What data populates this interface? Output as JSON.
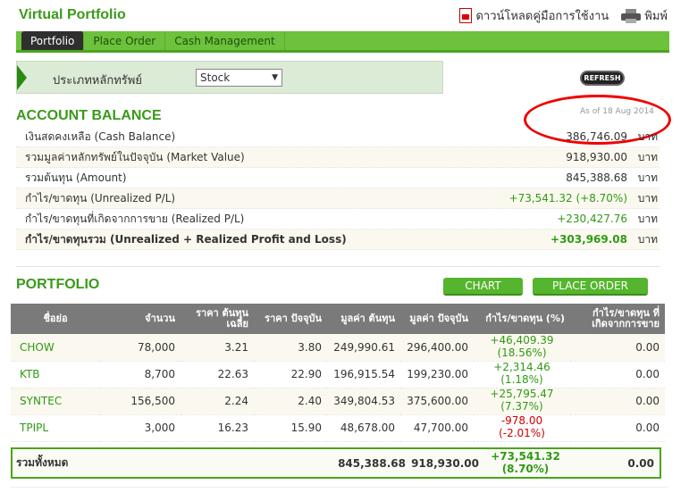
{
  "header": {
    "title": "Virtual Portfolio",
    "download_manual": "ดาวน์โหลดคู่มือการใช้งาน",
    "print": "พิมพ์"
  },
  "tabs": [
    {
      "label": "Portfolio",
      "active": true
    },
    {
      "label": "Place Order",
      "active": false
    },
    {
      "label": "Cash Management",
      "active": false
    }
  ],
  "filter": {
    "label": "ประเภทหลักทรัพย์",
    "selected": "Stock"
  },
  "refresh_label": "REFRESH",
  "account_balance": {
    "title": "ACCOUNT BALANCE",
    "as_of": "As of 18 Aug 2014",
    "rows": [
      {
        "label": "เงินสดคงเหลือ (Cash Balance)",
        "value": "386,746.09",
        "unit": "บาท"
      },
      {
        "label": "รวมมูลค่าหลักทรัพย์ในปัจจุบัน (Market Value)",
        "value": "918,930.00",
        "unit": "บาท"
      },
      {
        "label": "รวมต้นทุน (Amount)",
        "value": "845,388.68",
        "unit": "บาท"
      },
      {
        "label": "กำไร/ขาดทุน (Unrealized P/L)",
        "value": "+73,541.32 (+8.70%)",
        "unit": "บาท"
      },
      {
        "label": "กำไร/ขาดทุนที่เกิดจากการขาย (Realized P/L)",
        "value": "+230,427.76",
        "unit": "บาท"
      },
      {
        "label": "กำไร/ขาดทุนรวม (Unrealized + Realized Profit and Loss)",
        "value": "+303,969.08",
        "unit": "บาท"
      }
    ]
  },
  "portfolio": {
    "title": "PORTFOLIO",
    "chart_button": "CHART",
    "place_order_button": "PLACE ORDER",
    "columns": [
      "ชื่อย่อ",
      "จำนวน",
      "ราคา ต้นทุนเฉลี่ย",
      "ราคา ปัจจุบัน",
      "มูลค่า ต้นทุน",
      "มูลค่า ปัจจุบัน",
      "กำไร/ขาดทุน (%)",
      "กำไร/ขาดทุน ที่ เกิดจากการขาย"
    ],
    "rows": [
      {
        "symbol": "CHOW",
        "qty": "78,000",
        "avg_cost": "3.21",
        "price": "3.80",
        "cost_value": "249,990.61",
        "market_value": "296,400.00",
        "pl": "+46,409.39",
        "pl_pct": "(18.56%)",
        "realized": "0.00",
        "positive": true
      },
      {
        "symbol": "KTB",
        "qty": "8,700",
        "avg_cost": "22.63",
        "price": "22.90",
        "cost_value": "196,915.54",
        "market_value": "199,230.00",
        "pl": "+2,314.46",
        "pl_pct": "(1.18%)",
        "realized": "0.00",
        "positive": true
      },
      {
        "symbol": "SYNTEC",
        "qty": "156,500",
        "avg_cost": "2.24",
        "price": "2.40",
        "cost_value": "349,804.53",
        "market_value": "375,600.00",
        "pl": "+25,795.47",
        "pl_pct": "(7.37%)",
        "realized": "0.00",
        "positive": true
      },
      {
        "symbol": "TPIPL",
        "qty": "3,000",
        "avg_cost": "16.23",
        "price": "15.90",
        "cost_value": "48,678.00",
        "market_value": "47,700.00",
        "pl": "-978.00",
        "pl_pct": "(-2.01%)",
        "realized": "0.00",
        "positive": false
      }
    ],
    "total": {
      "label": "รวมทั้งหมด",
      "cost_value": "845,388.68",
      "market_value": "918,930.00",
      "pl": "+73,541.32",
      "pl_pct": "(8.70%)",
      "realized": "0.00"
    }
  },
  "colors": {
    "brand_green": "#3a9a1a",
    "positive": "#2e9a14",
    "negative": "#d10000",
    "annotation": "#e00000"
  }
}
